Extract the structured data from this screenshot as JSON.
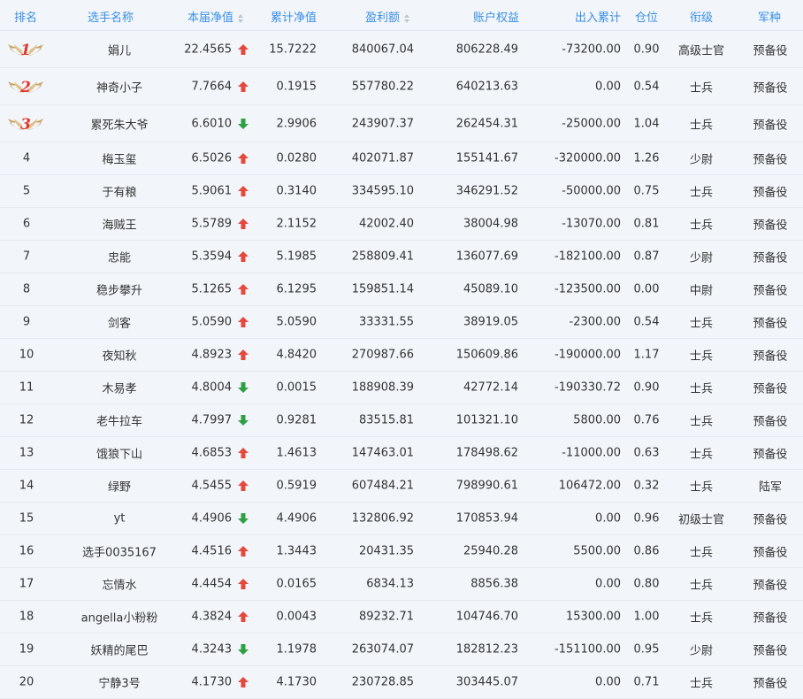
{
  "headers": {
    "rank": "排名",
    "name": "选手名称",
    "nav_current": "本届净值",
    "nav_cum": "累计净值",
    "profit": "盈利额",
    "equity": "账户权益",
    "inout": "出入累计",
    "position": "仓位",
    "title": "衔级",
    "branch": "军种"
  },
  "colors": {
    "header_text": "#3a8ee6",
    "up": "#e5483d",
    "down": "#2ea043",
    "medal_number": "#e03a2e"
  },
  "rows": [
    {
      "rank": "1",
      "name": "娟儿",
      "nav": "22.4565",
      "trend": "up",
      "cum": "15.7222",
      "profit": "840067.04",
      "equity": "806228.49",
      "inout": "-73200.00",
      "pos": "0.90",
      "title": "高级士官",
      "branch": "预备役"
    },
    {
      "rank": "2",
      "name": "神奇小子",
      "nav": "7.7664",
      "trend": "up",
      "cum": "0.1915",
      "profit": "557780.22",
      "equity": "640213.63",
      "inout": "0.00",
      "pos": "0.54",
      "title": "士兵",
      "branch": "预备役"
    },
    {
      "rank": "3",
      "name": "累死朱大爷",
      "nav": "6.6010",
      "trend": "down",
      "cum": "2.9906",
      "profit": "243907.37",
      "equity": "262454.31",
      "inout": "-25000.00",
      "pos": "1.04",
      "title": "士兵",
      "branch": "预备役"
    },
    {
      "rank": "4",
      "name": "梅玉玺",
      "nav": "6.5026",
      "trend": "up",
      "cum": "0.0280",
      "profit": "402071.87",
      "equity": "155141.67",
      "inout": "-320000.00",
      "pos": "1.26",
      "title": "少尉",
      "branch": "预备役"
    },
    {
      "rank": "5",
      "name": "于有粮",
      "nav": "5.9061",
      "trend": "up",
      "cum": "0.3140",
      "profit": "334595.10",
      "equity": "346291.52",
      "inout": "-50000.00",
      "pos": "0.75",
      "title": "士兵",
      "branch": "预备役"
    },
    {
      "rank": "6",
      "name": "海贼王",
      "nav": "5.5789",
      "trend": "up",
      "cum": "2.1152",
      "profit": "42002.40",
      "equity": "38004.98",
      "inout": "-13070.00",
      "pos": "0.81",
      "title": "士兵",
      "branch": "预备役"
    },
    {
      "rank": "7",
      "name": "忠能",
      "nav": "5.3594",
      "trend": "up",
      "cum": "5.1985",
      "profit": "258809.41",
      "equity": "136077.69",
      "inout": "-182100.00",
      "pos": "0.87",
      "title": "少尉",
      "branch": "预备役"
    },
    {
      "rank": "8",
      "name": "稳步攀升",
      "nav": "5.1265",
      "trend": "up",
      "cum": "6.1295",
      "profit": "159851.14",
      "equity": "45089.10",
      "inout": "-123500.00",
      "pos": "0.00",
      "title": "中尉",
      "branch": "预备役"
    },
    {
      "rank": "9",
      "name": "剑客",
      "nav": "5.0590",
      "trend": "up",
      "cum": "5.0590",
      "profit": "33331.55",
      "equity": "38919.05",
      "inout": "-2300.00",
      "pos": "0.54",
      "title": "士兵",
      "branch": "预备役"
    },
    {
      "rank": "10",
      "name": "夜知秋",
      "nav": "4.8923",
      "trend": "up",
      "cum": "4.8420",
      "profit": "270987.66",
      "equity": "150609.86",
      "inout": "-190000.00",
      "pos": "1.17",
      "title": "士兵",
      "branch": "预备役"
    },
    {
      "rank": "11",
      "name": "木易孝",
      "nav": "4.8004",
      "trend": "down",
      "cum": "0.0015",
      "profit": "188908.39",
      "equity": "42772.14",
      "inout": "-190330.72",
      "pos": "0.90",
      "title": "士兵",
      "branch": "预备役"
    },
    {
      "rank": "12",
      "name": "老牛拉车",
      "nav": "4.7997",
      "trend": "down",
      "cum": "0.9281",
      "profit": "83515.81",
      "equity": "101321.10",
      "inout": "5800.00",
      "pos": "0.76",
      "title": "士兵",
      "branch": "预备役"
    },
    {
      "rank": "13",
      "name": "饿狼下山",
      "nav": "4.6853",
      "trend": "up",
      "cum": "1.4613",
      "profit": "147463.01",
      "equity": "178498.62",
      "inout": "-11000.00",
      "pos": "0.63",
      "title": "士兵",
      "branch": "预备役"
    },
    {
      "rank": "14",
      "name": "绿野",
      "nav": "4.5455",
      "trend": "up",
      "cum": "0.5919",
      "profit": "607484.21",
      "equity": "798990.61",
      "inout": "106472.00",
      "pos": "0.32",
      "title": "士兵",
      "branch": "陆军"
    },
    {
      "rank": "15",
      "name": "yt",
      "nav": "4.4906",
      "trend": "down",
      "cum": "4.4906",
      "profit": "132806.92",
      "equity": "170853.94",
      "inout": "0.00",
      "pos": "0.96",
      "title": "初级士官",
      "branch": "预备役"
    },
    {
      "rank": "16",
      "name": "选手0035167",
      "nav": "4.4516",
      "trend": "up",
      "cum": "1.3443",
      "profit": "20431.35",
      "equity": "25940.28",
      "inout": "5500.00",
      "pos": "0.86",
      "title": "士兵",
      "branch": "预备役"
    },
    {
      "rank": "17",
      "name": "忘情水",
      "nav": "4.4454",
      "trend": "up",
      "cum": "0.0165",
      "profit": "6834.13",
      "equity": "8856.38",
      "inout": "0.00",
      "pos": "0.80",
      "title": "士兵",
      "branch": "预备役"
    },
    {
      "rank": "18",
      "name": "angella小粉粉",
      "nav": "4.3824",
      "trend": "up",
      "cum": "0.0043",
      "profit": "89232.71",
      "equity": "104746.70",
      "inout": "15300.00",
      "pos": "1.00",
      "title": "士兵",
      "branch": "预备役"
    },
    {
      "rank": "19",
      "name": "妖精的尾巴",
      "nav": "4.3243",
      "trend": "down",
      "cum": "1.1978",
      "profit": "263074.07",
      "equity": "182812.23",
      "inout": "-151100.00",
      "pos": "0.95",
      "title": "少尉",
      "branch": "预备役"
    },
    {
      "rank": "20",
      "name": "宁静3号",
      "nav": "4.1730",
      "trend": "up",
      "cum": "4.1730",
      "profit": "230728.85",
      "equity": "303445.07",
      "inout": "0.00",
      "pos": "0.71",
      "title": "士兵",
      "branch": "预备役"
    }
  ]
}
